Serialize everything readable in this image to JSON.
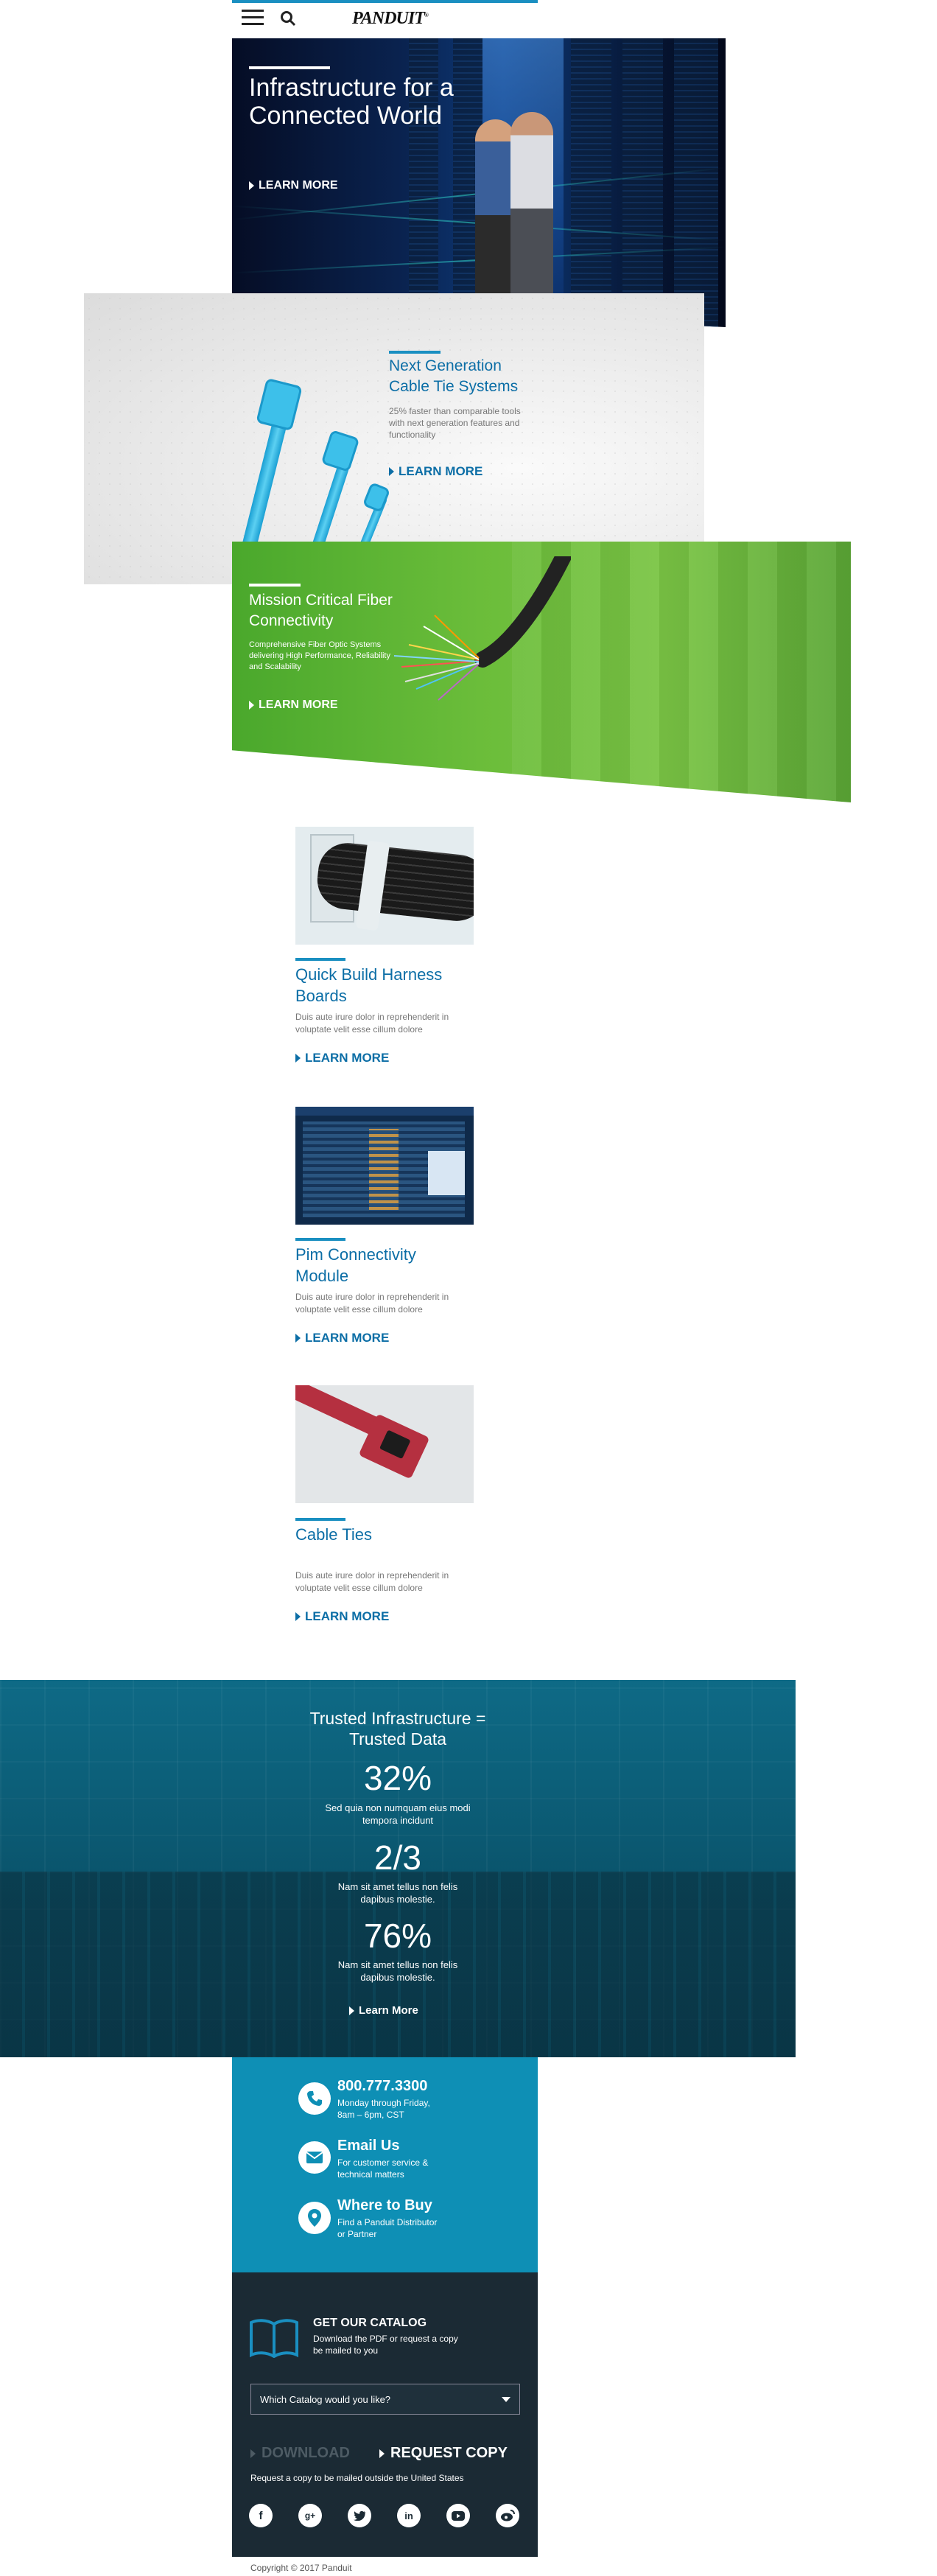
{
  "header": {
    "logo": "PANDUIT",
    "logo_mark": "®"
  },
  "hero1": {
    "title": "Infrastructure for a Connected World",
    "cta": "LEARN MORE"
  },
  "hero2": {
    "title": "Next Generation Cable Tie Systems",
    "desc": "25% faster than comparable tools with next generation features and functionality",
    "cta": "LEARN MORE"
  },
  "hero3": {
    "title": "Mission Critical Fiber Connectivity",
    "desc": "Comprehensive Fiber Optic Systems delivering High Performance, Reliability and Scalability",
    "cta": "LEARN MORE"
  },
  "cards": [
    {
      "title": "Quick Build Harness Boards",
      "desc": "Duis aute irure dolor in reprehenderit in voluptate velit esse cillum dolore",
      "cta": "LEARN MORE"
    },
    {
      "title": "Pim Connectivity Module",
      "desc": "Duis aute irure dolor in reprehenderit in voluptate velit esse cillum dolore",
      "cta": "LEARN MORE"
    },
    {
      "title": "Cable Ties",
      "desc": "Duis aute irure dolor in reprehenderit in voluptate velit esse cillum dolore",
      "cta": "LEARN MORE"
    }
  ],
  "stats": {
    "title": "Trusted Infrastructure = Trusted Data",
    "items": [
      {
        "value": "32%",
        "text": "Sed quia non numquam eius modi tempora incidunt"
      },
      {
        "value": "2/3",
        "text": "Nam sit amet tellus non felis dapibus molestie."
      },
      {
        "value": "76%",
        "text": "Nam sit amet tellus non felis dapibus molestie."
      }
    ],
    "cta": "Learn More"
  },
  "contact": [
    {
      "icon": "phone-icon",
      "title": "800.777.3300",
      "sub": "Monday through Friday, 8am – 6pm, CST"
    },
    {
      "icon": "envelope-icon",
      "title": "Email Us",
      "sub": "For customer service & technical matters"
    },
    {
      "icon": "location-pin-icon",
      "title": "Where to Buy",
      "sub": "Find a Panduit Distributor or Partner"
    }
  ],
  "catalog": {
    "title": "GET OUR CATALOG",
    "desc": "Download the PDF or request a copy be mailed to you",
    "select_placeholder": "Which Catalog would you like?",
    "download": "DOWNLOAD",
    "request": "REQUEST COPY",
    "note": "Request a copy to be mailed outside the United States"
  },
  "social": [
    "facebook-icon",
    "google-plus-icon",
    "twitter-icon",
    "linkedin-icon",
    "youtube-icon",
    "weibo-icon"
  ],
  "footer": {
    "copyright": "Copyright © 2017 Panduit"
  },
  "colors": {
    "brand_blue": "#0c6ea6",
    "accent": "#1a8fc1",
    "green": "#6bbd3a",
    "dark": "#1b2a34",
    "teal": "#0e8fb5"
  }
}
